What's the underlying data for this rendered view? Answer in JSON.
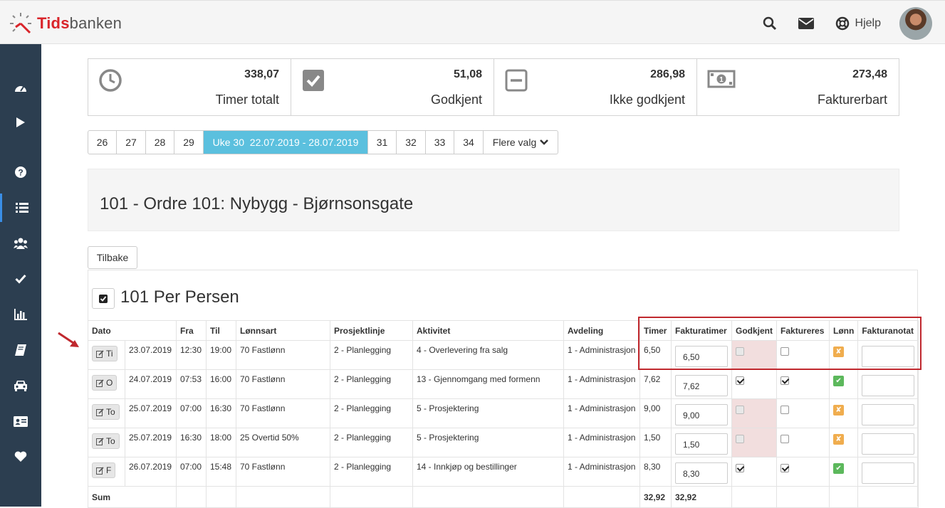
{
  "app": {
    "logo_part1": "Tids",
    "logo_part2": "banken",
    "help_label": "Hjelp",
    "colors": {
      "sidebar": "#2c3e50",
      "accent": "#5bc0de",
      "brand_red": "#d9242a",
      "highlight": "#c0282e"
    }
  },
  "topbar": {
    "icons": [
      "search-icon",
      "envelope-icon",
      "lifebuoy-icon"
    ]
  },
  "sidebar": {
    "items": [
      {
        "icon": "dashboard-icon"
      },
      {
        "icon": "play-icon"
      },
      {
        "icon": "question-icon"
      },
      {
        "icon": "list-icon",
        "active": true
      },
      {
        "icon": "users-icon"
      },
      {
        "icon": "check-icon"
      },
      {
        "icon": "bar-chart-icon"
      },
      {
        "icon": "book-icon"
      },
      {
        "icon": "car-icon"
      },
      {
        "icon": "id-card-icon"
      },
      {
        "icon": "heart-icon"
      }
    ]
  },
  "stats": [
    {
      "value": "338,07",
      "label": "Timer totalt",
      "icon": "clock-icon"
    },
    {
      "value": "51,08",
      "label": "Godkjent",
      "icon": "check-square-icon"
    },
    {
      "value": "286,98",
      "label": "Ikke godkjent",
      "icon": "minus-square-icon"
    },
    {
      "value": "273,48",
      "label": "Fakturerbart",
      "icon": "money-icon"
    }
  ],
  "weeks": {
    "before": [
      "26",
      "27",
      "28",
      "29"
    ],
    "current": "Uke 30  22.07.2019 - 28.07.2019",
    "after": [
      "31",
      "32",
      "33",
      "34"
    ],
    "more": "Flere valg"
  },
  "order": {
    "title": "101 - Ordre 101: Nybygg - Bjørnsonsgate"
  },
  "back_label": "Tilbake",
  "person": {
    "name": "101 Per Persen"
  },
  "table": {
    "headers": {
      "dato": "Dato",
      "fra": "Fra",
      "til": "Til",
      "lonnsart": "Lønnsart",
      "prosjektlinje": "Prosjektlinje",
      "aktivitet": "Aktivitet",
      "avdeling": "Avdeling",
      "timer": "Timer",
      "fakturatimer": "Fakturatimer",
      "godkjent": "Godkjent",
      "faktureres": "Faktureres",
      "lonn": "Lønn",
      "fakturanotat": "Fakturanotat"
    },
    "rows": [
      {
        "day": "Ti",
        "date": "23.07.2019",
        "fra": "12:30",
        "til": "19:00",
        "lonnsart": "70 Fastlønn",
        "prosjektlinje": "2 - Planlegging",
        "aktivitet": "4 - Overlevering fra salg",
        "avdeling": "1 - Administrasjon",
        "timer": "6,50",
        "fakturatimer": "6,50",
        "godkjent": false,
        "faktureres": false,
        "lonn": false
      },
      {
        "day": "O",
        "date": "24.07.2019",
        "fra": "07:53",
        "til": "16:00",
        "lonnsart": "70 Fastlønn",
        "prosjektlinje": "2 - Planlegging",
        "aktivitet": "13 - Gjennomgang med formenn",
        "avdeling": "1 - Administrasjon",
        "timer": "7,62",
        "fakturatimer": "7,62",
        "godkjent": true,
        "faktureres": true,
        "lonn": true
      },
      {
        "day": "To",
        "date": "25.07.2019",
        "fra": "07:00",
        "til": "16:30",
        "lonnsart": "70 Fastlønn",
        "prosjektlinje": "2 - Planlegging",
        "aktivitet": "5 - Prosjektering",
        "avdeling": "1 - Administrasjon",
        "timer": "9,00",
        "fakturatimer": "9,00",
        "godkjent": false,
        "faktureres": false,
        "lonn": false
      },
      {
        "day": "To",
        "date": "25.07.2019",
        "fra": "16:30",
        "til": "18:00",
        "lonnsart": "25 Overtid 50%",
        "prosjektlinje": "2 - Planlegging",
        "aktivitet": "5 - Prosjektering",
        "avdeling": "1 - Administrasjon",
        "timer": "1,50",
        "fakturatimer": "1,50",
        "godkjent": false,
        "faktureres": false,
        "lonn": false
      },
      {
        "day": "F",
        "date": "26.07.2019",
        "fra": "07:00",
        "til": "15:48",
        "lonnsart": "70 Fastlønn",
        "prosjektlinje": "2 - Planlegging",
        "aktivitet": "14 - Innkjøp og bestillinger",
        "avdeling": "1 - Administrasjon",
        "timer": "8,30",
        "fakturatimer": "8,30",
        "godkjent": true,
        "faktureres": true,
        "lonn": true
      }
    ],
    "sum": {
      "label": "Sum",
      "timer": "32,92",
      "fakturatimer": "32,92"
    }
  }
}
